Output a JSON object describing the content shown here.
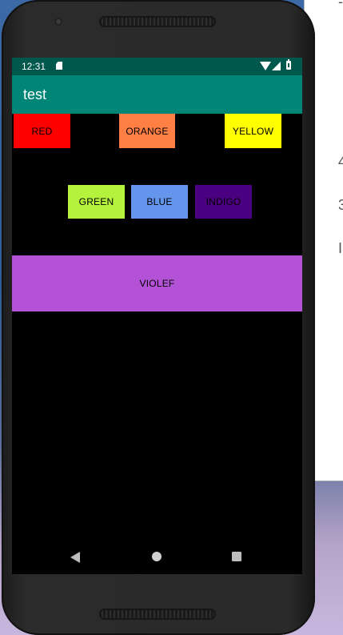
{
  "status_bar": {
    "time": "12:31",
    "icons": [
      "sd-card-icon",
      "wifi-icon",
      "signal-icon",
      "battery-icon"
    ]
  },
  "app_bar": {
    "title": "test"
  },
  "buttons": {
    "red": {
      "label": "RED",
      "color": "#ff0000"
    },
    "orange": {
      "label": "ORANGE",
      "color": "#ff7f45"
    },
    "yellow": {
      "label": "YELLOW",
      "color": "#ffff00"
    },
    "green": {
      "label": "GREEN",
      "color": "#b5f23e"
    },
    "blue": {
      "label": "BLUE",
      "color": "#6395ed"
    },
    "indigo": {
      "label": "INDIGO",
      "color": "#4b0082"
    },
    "violet": {
      "label": "VIOLEF",
      "color": "#b352d6"
    }
  },
  "nav_bar": {
    "icons": [
      "back-icon",
      "home-icon",
      "recents-icon"
    ]
  },
  "background_window": {
    "glyphs": [
      "-",
      "4",
      "3",
      "I"
    ]
  }
}
